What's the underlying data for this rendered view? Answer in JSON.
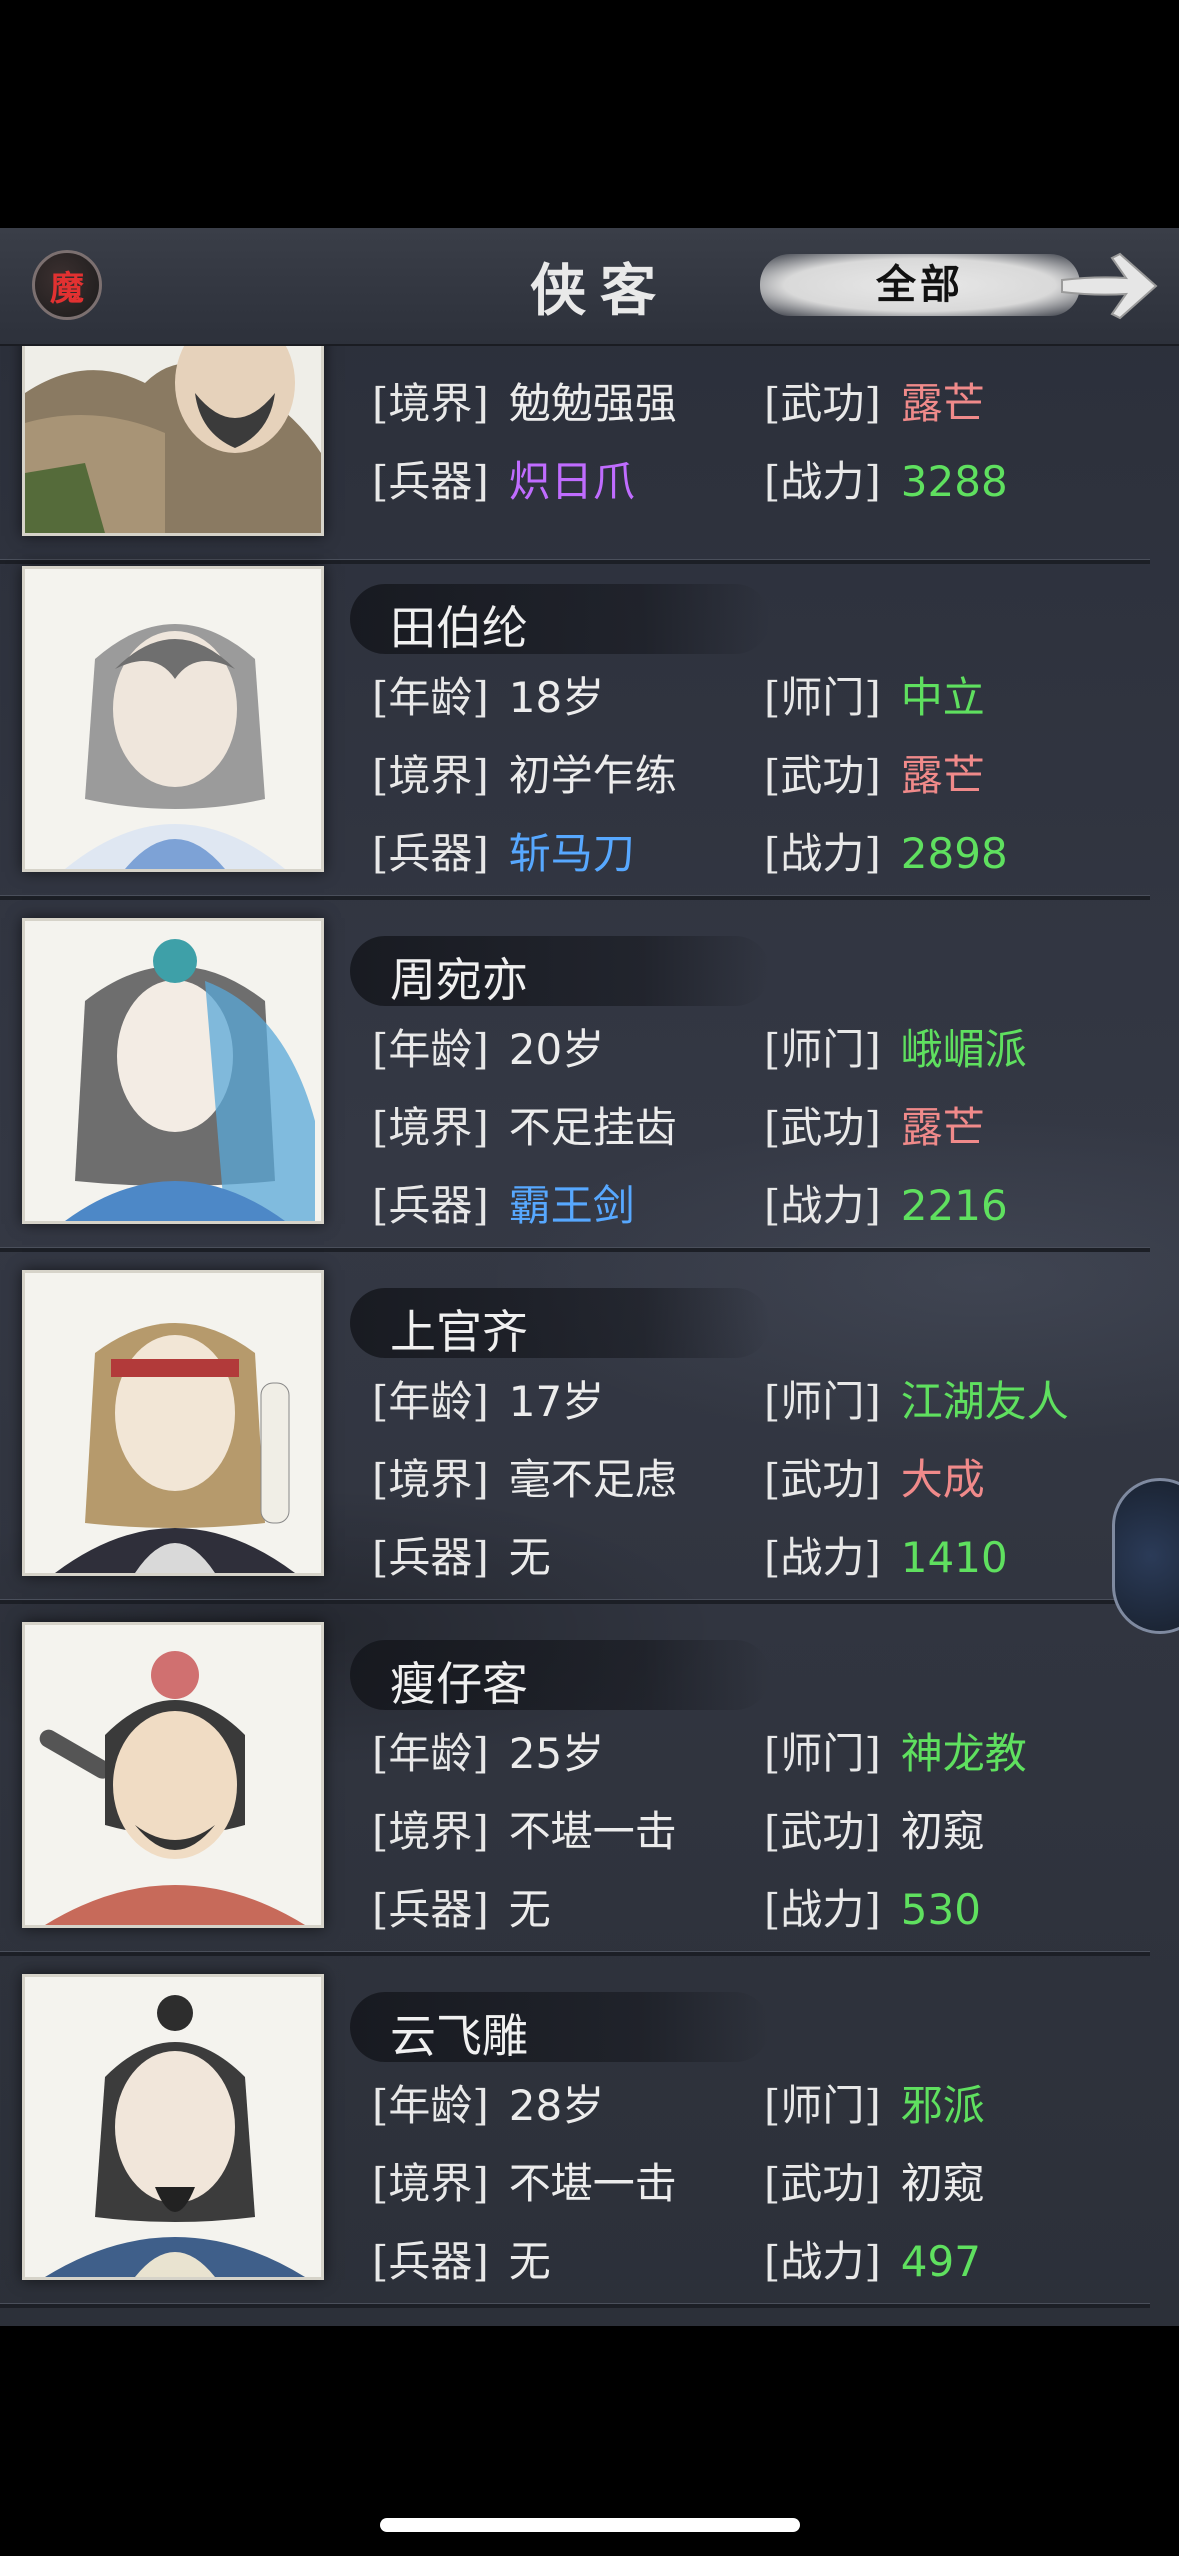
{
  "header": {
    "badge": "魔",
    "title": "侠客",
    "filter_label": "全部",
    "next_icon": "arrow-right-icon"
  },
  "labels": {
    "age": "[年龄]",
    "sect": "[师门]",
    "realm": "[境界]",
    "skill": "[武功]",
    "weapon": "[兵器]",
    "power": "[战力]"
  },
  "colors": {
    "red": "#f08a8a",
    "green": "#5fe05f",
    "purple": "#c06cff",
    "blue": "#57a8ff"
  },
  "heroes": [
    {
      "name": "",
      "age": "",
      "sect": "",
      "realm": "勉勉强强",
      "skill": "露芒",
      "weapon": "炽日爪",
      "weapon_color": "purple",
      "power": "3288",
      "sect_color": "green"
    },
    {
      "name": "田伯纶",
      "age": "18岁",
      "sect": "中立",
      "sect_color": "green",
      "realm": "初学乍练",
      "skill": "露芒",
      "skill_color": "red",
      "weapon": "斩马刀",
      "weapon_color": "blue",
      "power": "2898"
    },
    {
      "name": "周宛亦",
      "age": "20岁",
      "sect": "峨嵋派",
      "sect_color": "green",
      "realm": "不足挂齿",
      "skill": "露芒",
      "skill_color": "red",
      "weapon": "霸王剑",
      "weapon_color": "blue",
      "power": "2216"
    },
    {
      "name": "上官齐",
      "age": "17岁",
      "sect": "江湖友人",
      "sect_color": "green",
      "realm": "毫不足虑",
      "skill": "大成",
      "skill_color": "red",
      "weapon": "无",
      "weapon_color": "white",
      "power": "1410"
    },
    {
      "name": "瘦仔客",
      "age": "25岁",
      "sect": "神龙教",
      "sect_color": "green",
      "realm": "不堪一击",
      "skill": "初窥",
      "skill_color": "white",
      "weapon": "无",
      "weapon_color": "white",
      "power": "530"
    },
    {
      "name": "云飞雕",
      "age": "28岁",
      "sect": "邪派",
      "sect_color": "green",
      "realm": "不堪一击",
      "skill": "初窥",
      "skill_color": "white",
      "weapon": "无",
      "weapon_color": "white",
      "power": "497"
    }
  ]
}
